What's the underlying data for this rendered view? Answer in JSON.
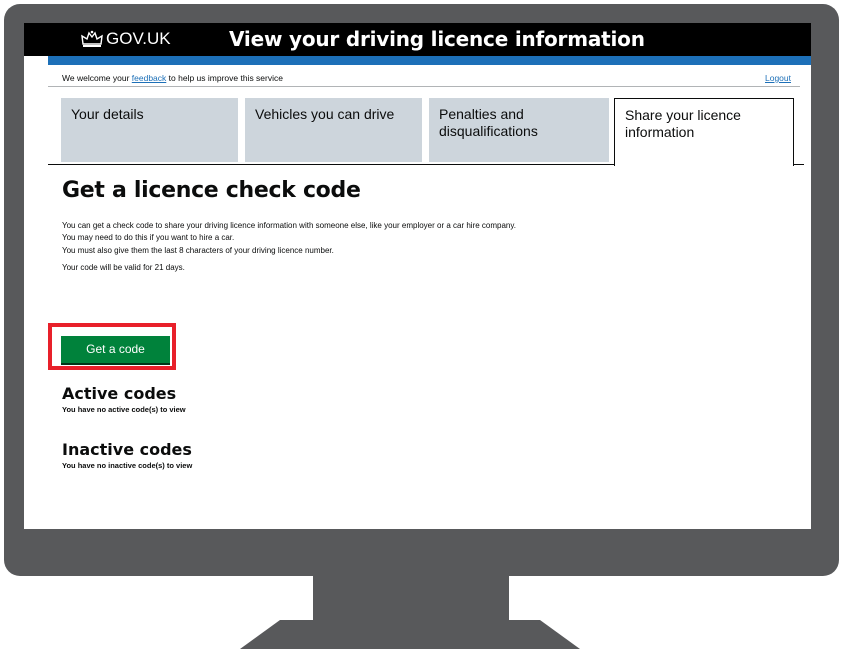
{
  "header": {
    "logo_text": "GOV.UK",
    "service_name": "View your driving licence information"
  },
  "feedback_bar": {
    "prefix": "We welcome your",
    "link_text": "feedback",
    "suffix": "to help us improve this service",
    "logout": "Logout"
  },
  "tabs": [
    {
      "label": "Your details"
    },
    {
      "label": "Vehicles you can drive"
    },
    {
      "label": "Penalties and disqualifications"
    },
    {
      "label": "Share your licence information"
    }
  ],
  "main": {
    "title": "Get a licence check code",
    "paragraphs": [
      "You can get a check code to share your driving licence information with someone else, like your employer or a car hire company.",
      "You may need to do this if you want to hire a car.",
      "You must also give them the last 8 characters of your driving licence number.",
      "Your code will be valid for 21 days."
    ],
    "button_label": "Get a code",
    "active_heading": "Active codes",
    "active_text": "You have no active code(s) to view",
    "inactive_heading": "Inactive codes",
    "inactive_text": "You have no inactive code(s) to view"
  },
  "colors": {
    "header": "#000000",
    "brand_blue": "#1d70b8",
    "button_green": "#00823b",
    "highlight_red": "#e8202a",
    "tab_inactive": "#cdd5dc",
    "monitor": "#58595b"
  }
}
